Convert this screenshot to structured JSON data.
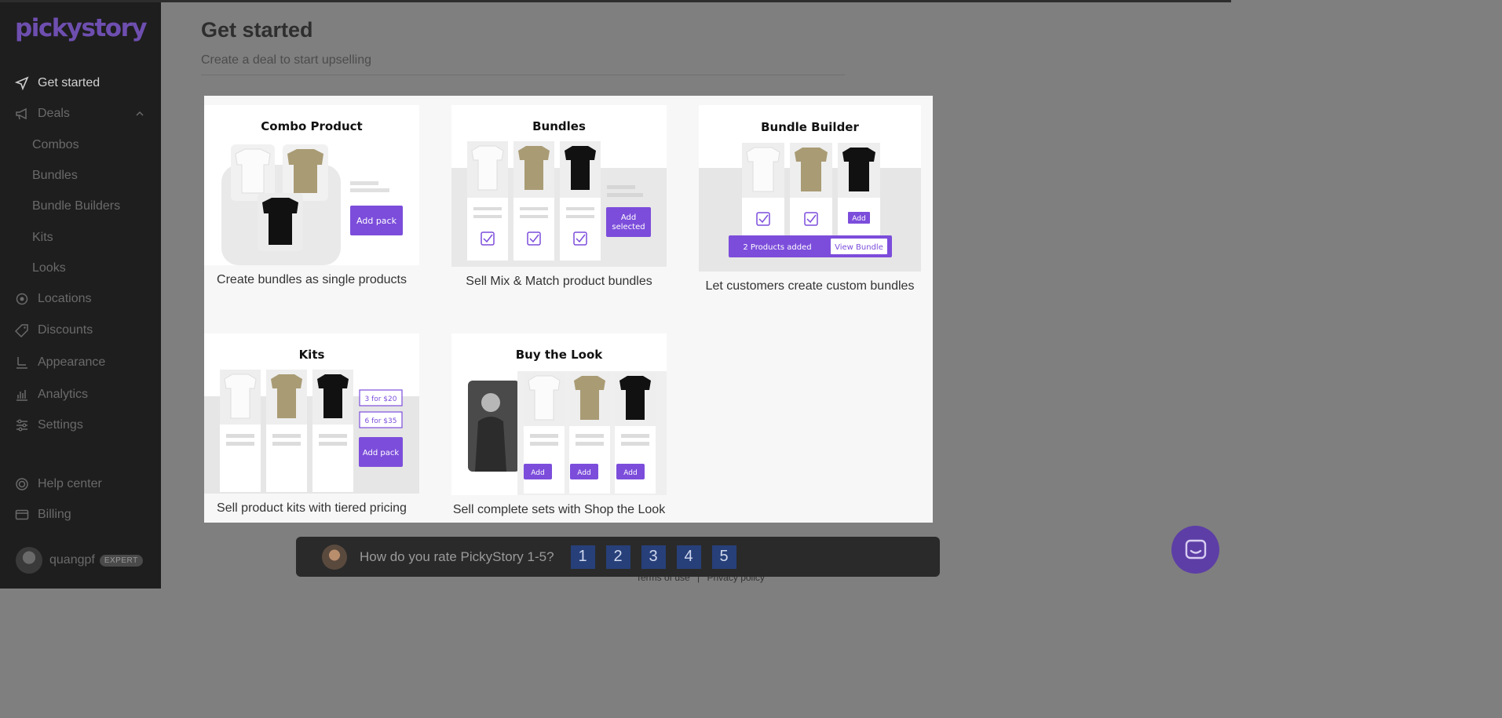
{
  "app": {
    "logo_text": "pickystory",
    "brand_color": "#7c4ddb"
  },
  "sidebar": {
    "items": [
      {
        "label": "Get started",
        "icon": "send-icon",
        "active": true
      },
      {
        "label": "Deals",
        "icon": "megaphone-icon",
        "expanded": true
      },
      {
        "label": "Locations",
        "icon": "location-icon"
      },
      {
        "label": "Discounts",
        "icon": "tag-icon"
      },
      {
        "label": "Appearance",
        "icon": "brush-icon"
      },
      {
        "label": "Analytics",
        "icon": "chart-icon"
      },
      {
        "label": "Settings",
        "icon": "sliders-icon"
      },
      {
        "label": "Help center",
        "icon": "lifebuoy-icon"
      },
      {
        "label": "Billing",
        "icon": "card-icon"
      }
    ],
    "deals_sub": [
      "Combos",
      "Bundles",
      "Bundle Builders",
      "Kits",
      "Looks"
    ],
    "user": {
      "name": "quangpf",
      "badge": "EXPERT"
    }
  },
  "main": {
    "title": "Get started",
    "subtitle": "Create a deal to start upselling"
  },
  "deal_types": [
    {
      "heading": "Combo Product",
      "caption": "Create bundles as single products",
      "button": "Add pack"
    },
    {
      "heading": "Bundles",
      "caption": "Sell Mix & Match product bundles",
      "button_line1": "Add",
      "button_line2": "selected"
    },
    {
      "heading": "Bundle Builder",
      "caption": "Let customers create custom bundles",
      "small_button": "Add",
      "bar_text": "2 Products added",
      "bar_button": "View Bundle"
    },
    {
      "heading": "Kits",
      "caption": "Sell product kits with tiered pricing",
      "tier1": "3 for $20",
      "tier2": "6 for $35",
      "button": "Add pack"
    },
    {
      "heading": "Buy the Look",
      "caption": "Sell complete sets with Shop the Look",
      "button": "Add"
    }
  ],
  "rating": {
    "question": "How do you rate PickyStory 1-5?",
    "options": [
      "1",
      "2",
      "3",
      "4",
      "5"
    ]
  },
  "footer": {
    "terms": "Terms of use",
    "separator": "|",
    "privacy": "Privacy policy"
  }
}
